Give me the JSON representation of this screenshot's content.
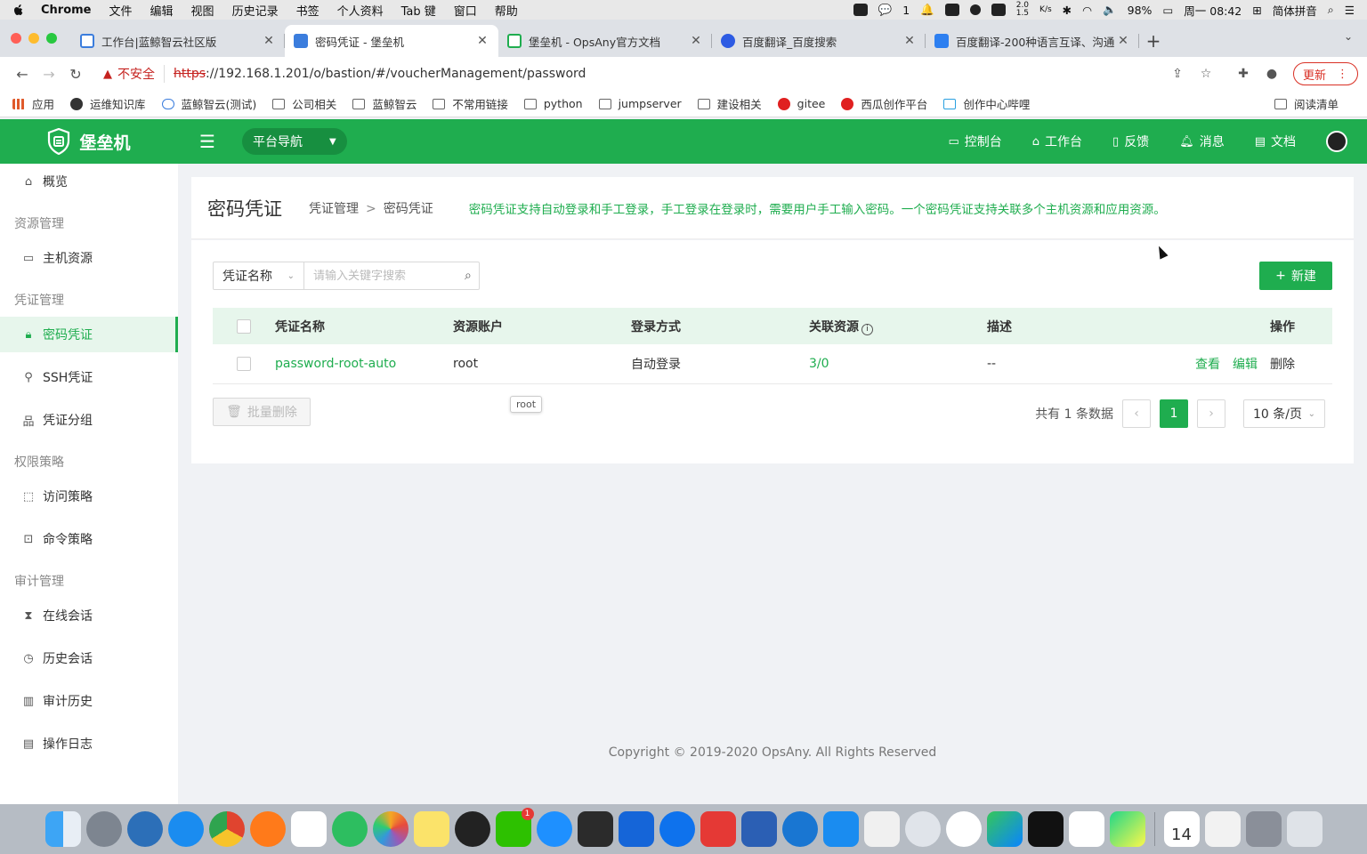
{
  "menubar": {
    "app": "Chrome",
    "items": [
      "文件",
      "编辑",
      "视图",
      "历史记录",
      "书签",
      "个人资料",
      "Tab 键",
      "窗口",
      "帮助"
    ],
    "status": {
      "wechat_count": "1",
      "net_up": "2.0",
      "net_down": "1.5",
      "net_unit": "K/s",
      "battery": "98%",
      "clock": "周一 08:42",
      "ime": "简体拼音"
    }
  },
  "tabs": [
    {
      "title": "工作台|蓝鲸智云社区版",
      "favicon_color": "#3b7ddd",
      "active": false
    },
    {
      "title": "密码凭证 - 堡垒机",
      "favicon_color": "#3b7ddd",
      "active": true
    },
    {
      "title": "堡垒机 - OpsAny官方文档",
      "favicon_color": "#1fad4f",
      "active": false
    },
    {
      "title": "百度翻译_百度搜索",
      "favicon_color": "#2d5be3",
      "active": false
    },
    {
      "title": "百度翻译-200种语言互译、沟通",
      "favicon_color": "#2d7ff0",
      "active": false
    }
  ],
  "address": {
    "insecure_label": "不安全",
    "scheme": "https",
    "rest": "://192.168.1.201/o/bastion/#/voucherManagement/password",
    "update_label": "更新"
  },
  "bookmarks": [
    "应用",
    "运维知识库",
    "蓝鲸智云(测试)",
    "公司相关",
    "蓝鲸智云",
    "不常用链接",
    "python",
    "jumpserver",
    "建设相关",
    "gitee",
    "西瓜创作平台",
    "创作中心哔哩"
  ],
  "reading_list": "阅读清单",
  "header": {
    "logo_text": "堡垒机",
    "platform_nav": "平台导航",
    "links": [
      {
        "label": "控制台",
        "icon": "monitor-icon"
      },
      {
        "label": "工作台",
        "icon": "home-icon"
      },
      {
        "label": "反馈",
        "icon": "feedback-icon"
      },
      {
        "label": "消息",
        "icon": "bell-icon"
      },
      {
        "label": "文档",
        "icon": "document-icon"
      }
    ]
  },
  "sidebar": {
    "overview": "概览",
    "groups": {
      "resource": "资源管理",
      "credential": "凭证管理",
      "permission": "权限策略",
      "audit": "审计管理"
    },
    "items": {
      "host": "主机资源",
      "password": "密码凭证",
      "ssh": "SSH凭证",
      "group": "凭证分组",
      "access": "访问策略",
      "command": "命令策略",
      "online": "在线会话",
      "history_session": "历史会话",
      "audit_history": "审计历史",
      "op_log": "操作日志"
    }
  },
  "page": {
    "title": "密码凭证",
    "breadcrumb": [
      "凭证管理",
      "密码凭证"
    ],
    "description": "密码凭证支持自动登录和手工登录，手工登录在登录时，需要用户手工输入密码。一个密码凭证支持关联多个主机资源和应用资源。"
  },
  "filter": {
    "field": "凭证名称",
    "placeholder": "请输入关键字搜索"
  },
  "new_button": "新建",
  "table": {
    "columns": [
      "凭证名称",
      "资源账户",
      "登录方式",
      "关联资源",
      "描述",
      "操作"
    ],
    "rows": [
      {
        "name": "password-root-auto",
        "account": "root",
        "login": "自动登录",
        "resources": "3/0",
        "desc": "--",
        "actions": [
          "查看",
          "编辑",
          "删除"
        ]
      }
    ]
  },
  "tooltip": "root",
  "batch_delete": "批量删除",
  "pagination": {
    "total": "共有 1 条数据",
    "current": "1",
    "page_size": "10 条/页"
  },
  "footer": "Copyright © 2019-2020 OpsAny. All Rights Reserved",
  "dock": {
    "calendar_day": "14",
    "wechat_badge": "1"
  }
}
